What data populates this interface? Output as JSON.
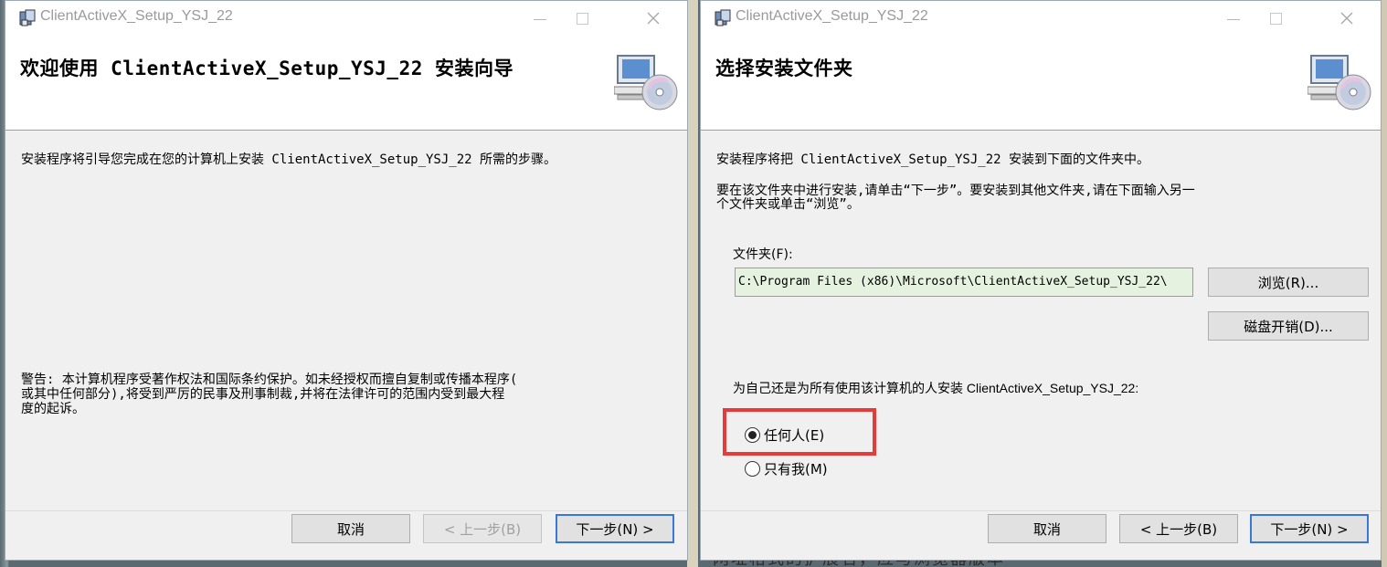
{
  "windows": [
    {
      "title": "ClientActiveX_Setup_YSJ_22",
      "banner_title": "欢迎使用 ClientActiveX_Setup_YSJ_22 安装向导",
      "intro_text": "安装程序将引导您完成在您的计算机上安装 ClientActiveX_Setup_YSJ_22 所需的步骤。",
      "warning_lines": [
        "警告: 本计算机程序受著作权法和国际条约保护。如未经授权而擅自复制或传播本程序(",
        "或其中任何部分),将受到严厉的民事及刑事制裁,并将在法律许可的范围内受到最大程",
        "度的起诉。"
      ],
      "buttons": {
        "cancel": "取消",
        "back": "< 上一步(B)",
        "next": "下一步(N) >"
      }
    },
    {
      "title": "ClientActiveX_Setup_YSJ_22",
      "banner_title": "选择安装文件夹",
      "intro_text": "安装程序将把 ClientActiveX_Setup_YSJ_22 安装到下面的文件夹中。",
      "instruction_lines": [
        "要在该文件夹中进行安装,请单击“下一步”。要安装到其他文件夹,请在下面输入另一",
        "个文件夹或单击“浏览”。"
      ],
      "folder_label": "文件夹(F):",
      "folder_value": "C:\\Program Files (x86)\\Microsoft\\ClientActiveX_Setup_YSJ_22\\",
      "browse_label": "浏览(R)...",
      "disk_cost_label": "磁盘开销(D)...",
      "install_for_label": "为自己还是为所有使用该计算机的人安装 ClientActiveX_Setup_YSJ_22:",
      "radio_everyone": "任何人(E)",
      "radio_just_me": "只有我(M)",
      "selected_option": "everyone",
      "buttons": {
        "cancel": "取消",
        "back": "< 上一步(B)",
        "next": "下一步(N) >"
      }
    }
  ],
  "background_text": "网址格式的扩展名，应与浏览器版本"
}
